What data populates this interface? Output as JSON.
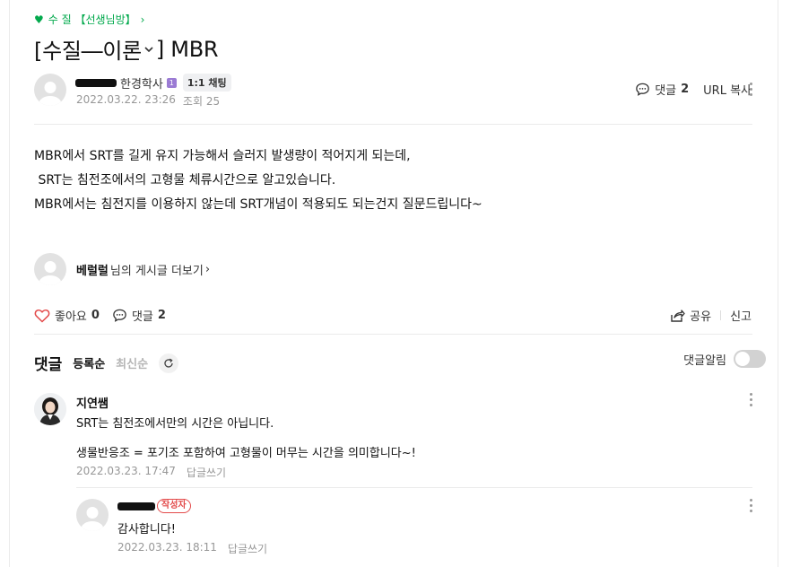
{
  "cafe": {
    "board_link": "수 질 【선생님방】"
  },
  "post": {
    "title": "[수질―이론",
    "title_tail": "] MBR",
    "author_visible": "한경학사",
    "grade_mark": "1",
    "chat_label": "1:1 채팅",
    "date": "2022.03.22. 23:26",
    "views": "조회 25",
    "comment_label": "댓글",
    "comment_count": "2",
    "url_copy": "URL 복사",
    "body": [
      "MBR에서 SRT를 길게 유지 가능해서 슬러지 발생량이 적어지게 되는데,",
      " SRT는 침전조에서의 고형물 체류시간으로 알고있습니다.",
      "MBR에서는 침전지를 이용하지 않는데 SRT개념이 적용되도 되는건지 질문드립니다~"
    ]
  },
  "more_posts": {
    "nickname": "베럴럴",
    "suffix": "님의 게시글 더보기"
  },
  "reactions": {
    "like_label": "좋아요",
    "like_count": "0",
    "comment_label": "댓글",
    "comment_count": "2",
    "share_label": "공유",
    "report_label": "신고"
  },
  "comments_section": {
    "title": "댓글",
    "sort_register": "등록순",
    "sort_latest": "최신순",
    "notify_label": "댓글알림"
  },
  "comments": [
    {
      "author": "지연쌤",
      "line1": "SRT는 침전조에서만의 시간은 아닙니다.",
      "line2": "생물반응조 = 포기조 포함하여 고형물이 머무는 시간을 의미합니다~!",
      "date": "2022.03.23. 17:47",
      "reply_label": "답글쓰기"
    },
    {
      "writer_badge": "작성자",
      "text": "감사합니다!",
      "date": "2022.03.23. 18:11",
      "reply_label": "답글쓰기"
    }
  ],
  "colors": {
    "brand": "#03a94d",
    "badge_red": "#e34a4a",
    "meta_gray": "#979797"
  }
}
